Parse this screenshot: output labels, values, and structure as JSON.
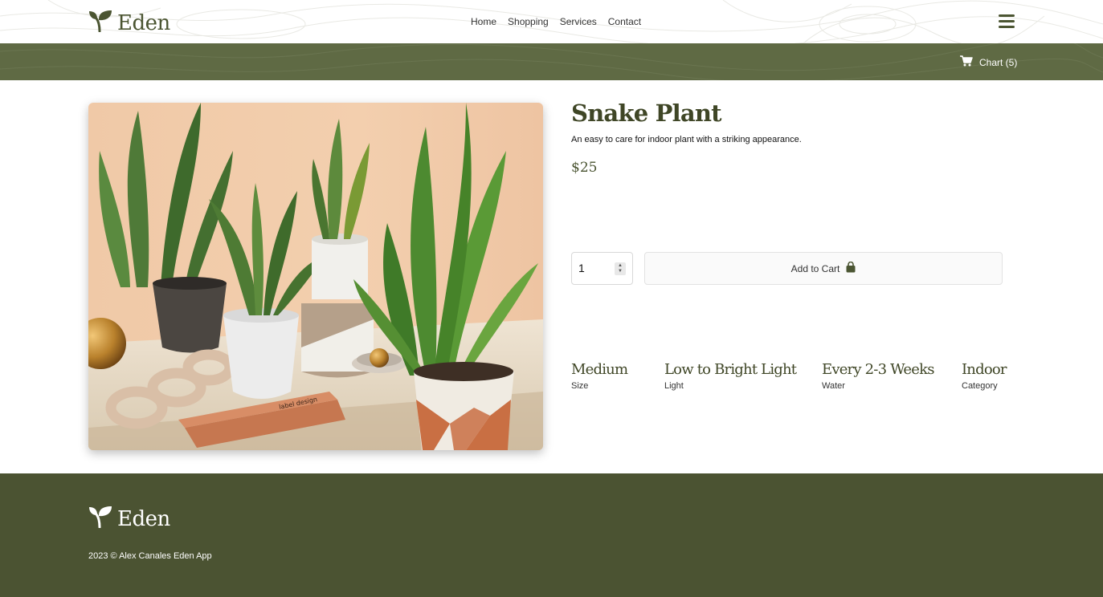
{
  "brand": {
    "name": "Eden",
    "logo_icon": "sprout-icon"
  },
  "nav": {
    "items": [
      "Home",
      "Shopping",
      "Services",
      "Contact"
    ],
    "menu_icon": "hamburger-icon"
  },
  "cart": {
    "label": "Chart (5)",
    "icon": "cart-icon"
  },
  "product": {
    "image_icon": "snake-plant-photo",
    "title": "Snake Plant",
    "description": "An easy to care for indoor plant with a striking appearance.",
    "price": "$25",
    "quantity": "1",
    "add_to_cart_label": "Add to Cart",
    "add_to_cart_icon": "shopping-bag-icon",
    "attributes": [
      {
        "value": "Medium",
        "label": "Size"
      },
      {
        "value": "Low to Bright Light",
        "label": "Light"
      },
      {
        "value": "Every 2-3 Weeks",
        "label": "Water"
      },
      {
        "value": "Indoor",
        "label": "Category"
      }
    ]
  },
  "footer": {
    "brand": "Eden",
    "copyright": "2023 © Alex Canales Eden App"
  },
  "colors": {
    "primary": "#4b5532",
    "subbar": "#5f6a44",
    "footer": "#4b5332"
  }
}
